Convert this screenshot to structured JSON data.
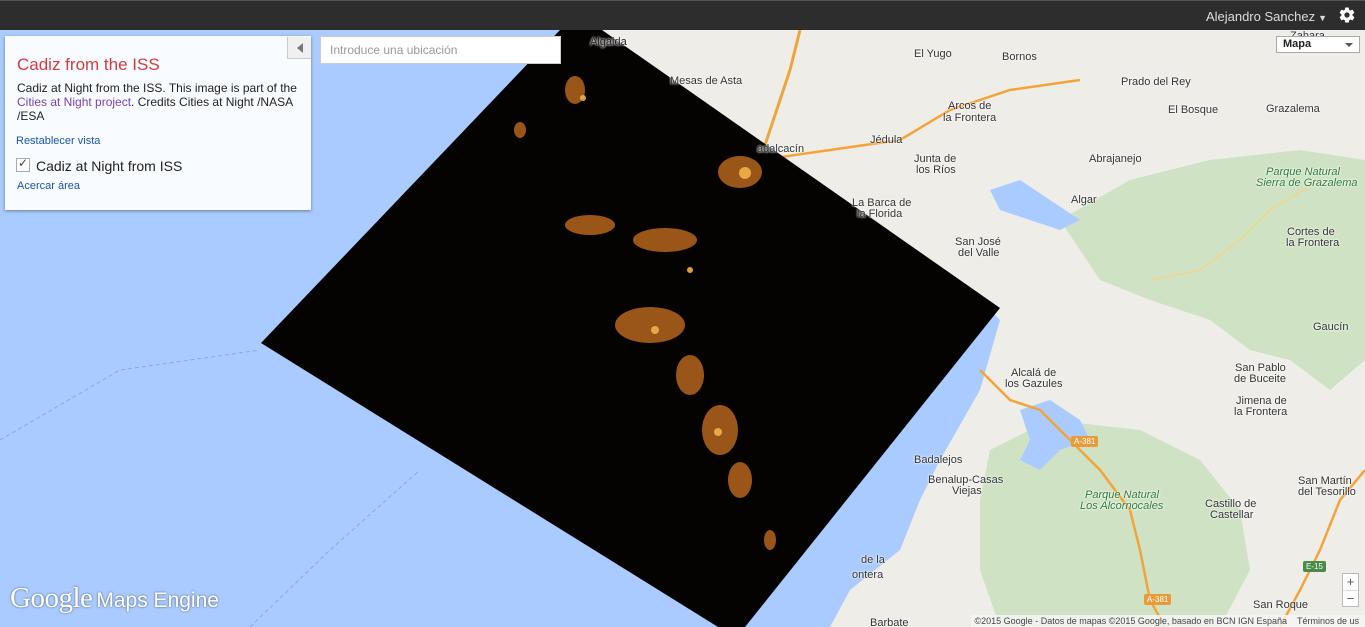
{
  "topbar": {
    "user_name": "Alejandro Sanchez"
  },
  "panel": {
    "title": "Cadiz from the ISS",
    "desc_before": "Cadiz at Night from the ISS. This image is part of the ",
    "desc_link": "Cities at Night project",
    "desc_after": ". Credits Cities at Night /NASA /ESA",
    "reset_view": "Restablecer vista",
    "layer_name": "Cadiz at Night from ISS",
    "layer_checked": true,
    "zoom_area": "Acercar área"
  },
  "search": {
    "placeholder": "Introduce una ubicación"
  },
  "map_type": {
    "selected": "Mapa"
  },
  "zoom": {
    "in": "+",
    "out": "−"
  },
  "places": [
    "Algaida",
    "El Yugo",
    "Bornos",
    "Zahara",
    "Mesas de Asta",
    "Prado del Rey",
    "Arcos de",
    "la Frontera",
    "El Bosque",
    "Grazalema",
    "adalcacín",
    "Jédula",
    "Abrajanejo",
    "Junta de",
    "los Ríos",
    "Parque Natural",
    "Sierra de Grazalema",
    "La Barca de",
    "la Florida",
    "Algar",
    "Cortes de",
    "la Frontera",
    "San José",
    "del Valle",
    "Gaucín",
    "Alcalá de",
    "los Gazules",
    "San Pablo",
    "de Buceite",
    "Jimena de",
    "la Frontera",
    "Badalejos",
    "Benalup-Casas",
    "Viejas",
    "Parque Natural",
    "Los Alcornocales",
    "San Martín",
    "del Tesorillo",
    "Castillo de",
    "Castellar",
    "de la",
    "ontera",
    "San Roque",
    "Barbate"
  ],
  "roads": [
    "A-381",
    "A-381",
    "E-15"
  ],
  "logo": {
    "brand": "Google",
    "product": "Maps Engine"
  },
  "attribution": {
    "copyright": "©2015 Google - Datos de mapas ©2015 Google, basado en BCN IGN España",
    "terms": "Términos de us"
  },
  "colors": {
    "sea": "#aacbff",
    "land": "#eeede8",
    "park": "#cfe3c4",
    "highway": "#f2a43a",
    "overlay": "#050302",
    "title_red": "#d33c3c",
    "link_blue": "#1a55b0",
    "link_purple": "#7b3fb0"
  }
}
